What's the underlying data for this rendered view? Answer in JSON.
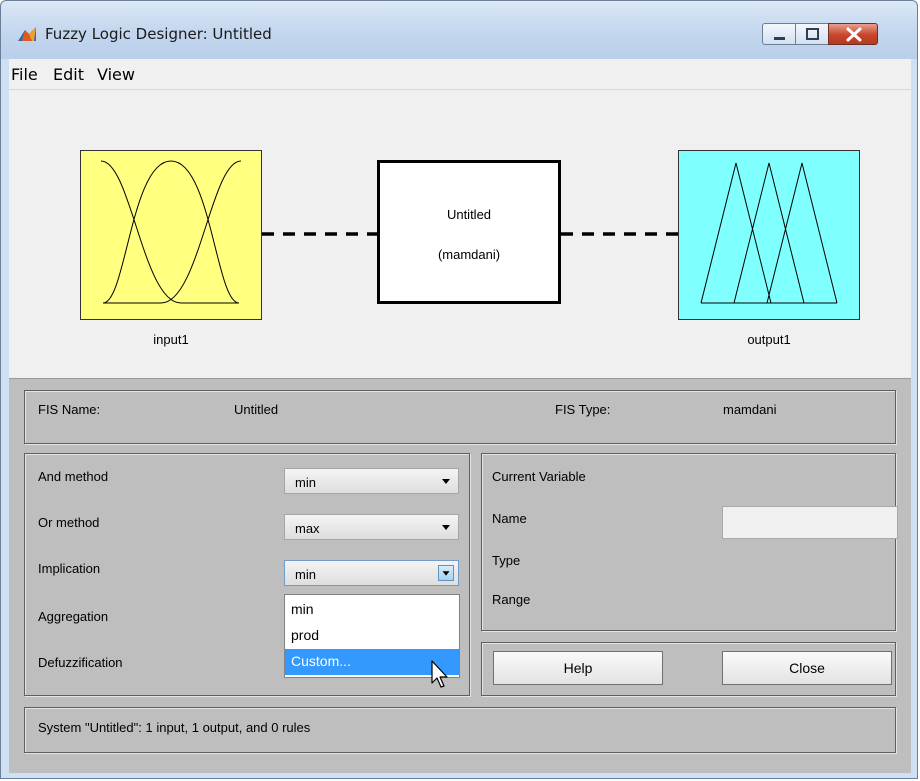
{
  "window": {
    "title": "Fuzzy Logic Designer: Untitled",
    "icon": "matlab-icon",
    "controls": [
      "minimize-icon",
      "maximize-icon",
      "close-icon"
    ]
  },
  "menu": {
    "items": [
      "File",
      "Edit",
      "View"
    ]
  },
  "diagram": {
    "input_label": "input1",
    "output_label": "output1",
    "system_name": "Untitled",
    "system_type": "(mamdani)",
    "colors": {
      "input_fill": "#ffff80",
      "output_fill": "#80ffff"
    }
  },
  "fis_info": {
    "name_label": "FIS Name:",
    "name_value": "Untitled",
    "type_label": "FIS Type:",
    "type_value": "mamdani"
  },
  "methods": {
    "and_label": "And method",
    "and_value": "min",
    "or_label": "Or method",
    "or_value": "max",
    "implication_label": "Implication",
    "implication_value": "min",
    "aggregation_label": "Aggregation",
    "defuzzification_label": "Defuzzification",
    "implication_options": [
      "min",
      "prod",
      "Custom..."
    ],
    "implication_highlighted": "Custom..."
  },
  "current_variable": {
    "heading": "Current Variable",
    "name_label": "Name",
    "name_value": "",
    "type_label": "Type",
    "range_label": "Range"
  },
  "buttons": {
    "help": "Help",
    "close": "Close"
  },
  "status": {
    "text": "System \"Untitled\": 1 input, 1 output, and 0 rules"
  }
}
